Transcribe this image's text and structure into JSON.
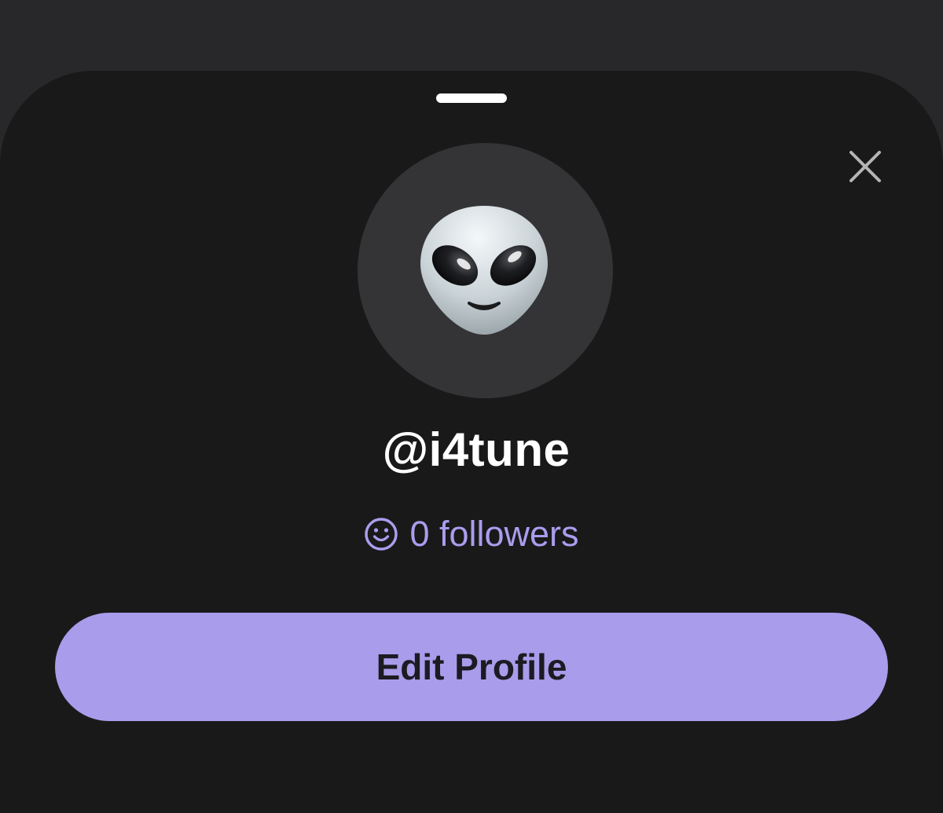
{
  "profile": {
    "username": "@i4tune",
    "followers_label": "0 followers",
    "avatar_icon": "alien-emoji"
  },
  "actions": {
    "edit_profile_label": "Edit Profile",
    "close_icon": "close-icon"
  },
  "colors": {
    "accent": "#a99ceb",
    "followers_text": "#ab9ded",
    "sheet_background": "#19191a",
    "backdrop": "#28282b",
    "avatar_circle": "#343436"
  }
}
